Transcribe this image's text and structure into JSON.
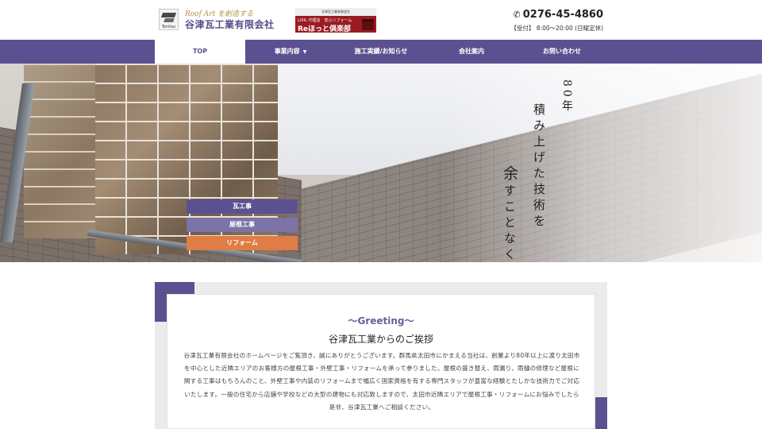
{
  "header": {
    "logo_mark_text": "Tonitsu",
    "logo_tagline": "Roof Art を創造する",
    "logo_company": "谷津瓦工業有限会社",
    "banner_top": "谷津瓦工業有限会社",
    "banner_sub": "LIXIL 代理店　安心リフォーム",
    "banner_main": "Reほっと倶楽部",
    "phone": "0276-45-4860",
    "phone_icon": "phone-icon",
    "hours": "【受付】 8:00～20:00 (日曜定休)"
  },
  "nav": {
    "items": [
      {
        "label": "TOP",
        "active": true
      },
      {
        "label": "事業内容",
        "has_dropdown": true
      },
      {
        "label": "施工実績/お知らせ"
      },
      {
        "label": "会社案内"
      },
      {
        "label": "お問い合わせ"
      }
    ],
    "colors": {
      "bar": "#5c5190",
      "active_bg": "#ffffff"
    }
  },
  "hero": {
    "catchphrase": {
      "line1": "80年",
      "line2": "積み上げた技術を",
      "line3_big": "余",
      "line3_rest": "すことなく"
    },
    "buttons": [
      {
        "label": "瓦工事",
        "color": "#5c5190"
      },
      {
        "label": "屋根工事",
        "color": "#7d73a8"
      },
      {
        "label": "リフォーム",
        "color": "#e07c45"
      }
    ]
  },
  "greeting": {
    "heading_en": "～Greeting～",
    "title": "谷津瓦工業からのご挨拶",
    "body": "谷津瓦工業有限会社のホームページをご覧頂き、誠にありがとうございます。群馬県太田市にかまえる当社は、創業より80年以上に渡り太田市を中心とした近隣エリアのお客様方の屋根工事・外壁工事・リフォームを承って参りました。屋根の葺き替え、雨漏り、雨樋の修理など屋根に関する工事はもちろんのこと、外壁工事や内装のリフォームまで幅広く国家資格を有する専門スタッフが豊富な経験とたしかな技術力でご対応いたします。一般の住宅から店舗や学校などの大型の建物にも対応致しますので、太田市近隣エリアで屋根工事・リフォームにお悩みでしたら是非、谷津瓦工業へご相談ください。"
  }
}
